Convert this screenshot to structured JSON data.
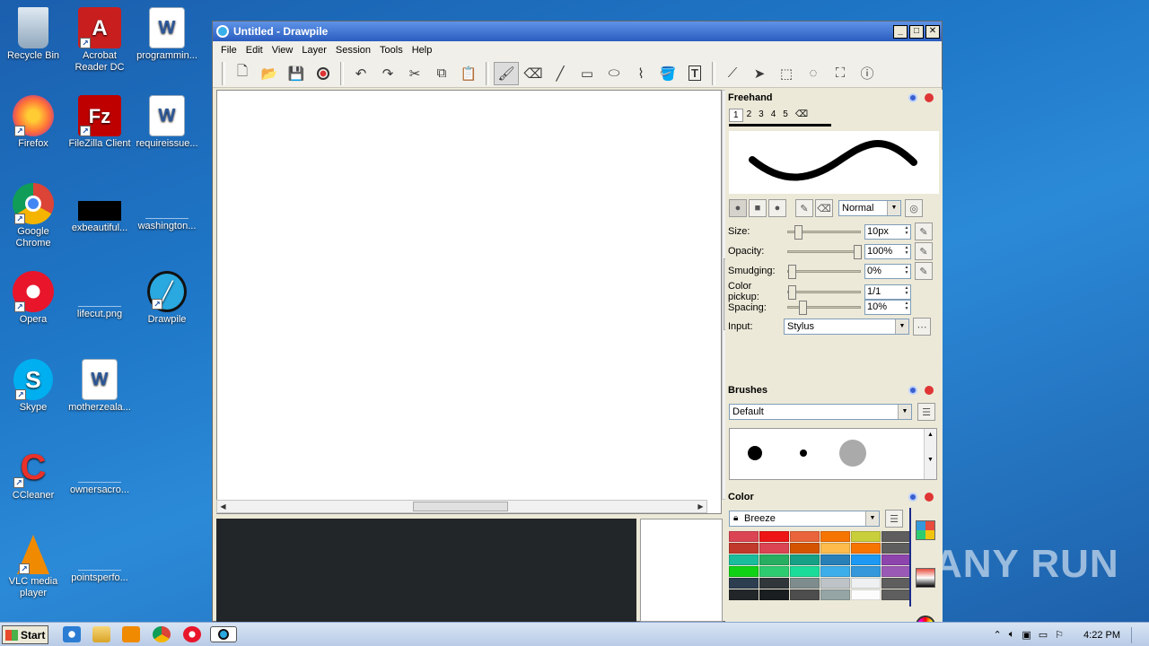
{
  "desktop": {
    "icons": [
      {
        "label": "Recycle Bin"
      },
      {
        "label": "Acrobat Reader DC"
      },
      {
        "label": "programmin..."
      },
      {
        "label": "Firefox"
      },
      {
        "label": "FileZilla Client"
      },
      {
        "label": "requireissue..."
      },
      {
        "label": "Google Chrome"
      },
      {
        "label": "exbeautiful..."
      },
      {
        "label": "washington..."
      },
      {
        "label": "Opera"
      },
      {
        "label": "lifecut.png"
      },
      {
        "label": "Drawpile"
      },
      {
        "label": "Skype"
      },
      {
        "label": "motherzeala..."
      },
      {
        "label": "CCleaner"
      },
      {
        "label": "ownersacro..."
      },
      {
        "label": "VLC media player"
      },
      {
        "label": "pointsperfo..."
      }
    ],
    "watermark": "ANY RUN"
  },
  "window": {
    "title": "Untitled - Drawpile",
    "menu": [
      "File",
      "Edit",
      "View",
      "Layer",
      "Session",
      "Tools",
      "Help"
    ]
  },
  "freehand": {
    "title": "Freehand",
    "presets": [
      "1",
      "2",
      "3",
      "4",
      "5"
    ],
    "blend_mode": "Normal",
    "size_label": "Size:",
    "size_value": "10px",
    "size_level": 0.1,
    "opacity_label": "Opacity:",
    "opacity_value": "100%",
    "opacity_level": 1.0,
    "smudging_label": "Smudging:",
    "smudging_value": "0%",
    "smudging_level": 0.0,
    "colorpickup_label": "Color pickup:",
    "colorpickup_value": "1/1",
    "colorpickup_level": 0.0,
    "spacing_label": "Spacing:",
    "spacing_value": "10%",
    "spacing_level": 0.16,
    "input_label": "Input:",
    "input_value": "Stylus"
  },
  "brushes": {
    "title": "Brushes",
    "selected": "Default"
  },
  "color": {
    "title": "Color",
    "palette": "Breeze",
    "swatches": [
      "#da4453",
      "#ed1515",
      "#e9643a",
      "#f67400",
      "#c9ce3b",
      "#5e5e5e",
      "#c0392b",
      "#da4453",
      "#d35400",
      "#fdbc4b",
      "#f67400",
      "#5e5e5e",
      "#1abc9c",
      "#27ae60",
      "#16a085",
      "#2980b9",
      "#1d99f3",
      "#8e44ad",
      "#11d116",
      "#2ecc71",
      "#1cdc9a",
      "#3daee9",
      "#3498db",
      "#9b59b6",
      "#2c3e50",
      "#31363b",
      "#7f8c8d",
      "#bdc3c7",
      "#eff0f1",
      "#5e5e5e",
      "#232629",
      "#1b1e20",
      "#4d4d4d",
      "#95a5a6",
      "#fcfcfc",
      "#5e5e5e"
    ]
  },
  "taskbar": {
    "start_label": "Start",
    "clock": "4:22 PM"
  }
}
